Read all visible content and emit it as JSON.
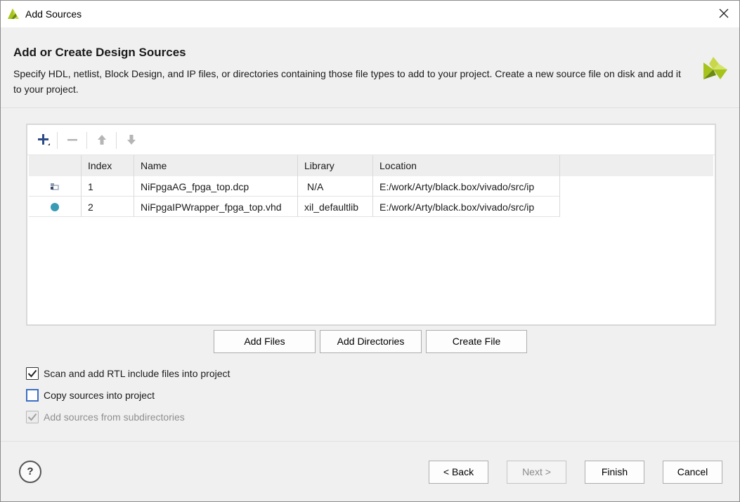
{
  "window": {
    "title": "Add Sources"
  },
  "header": {
    "title": "Add or Create Design Sources",
    "description": "Specify HDL, netlist, Block Design, and IP files, or directories containing those file types to add to your project. Create a new source file on disk and add it to your project."
  },
  "toolbar": {
    "add_icon": "plus-icon",
    "remove_icon": "minus-icon",
    "up_icon": "arrow-up-icon",
    "down_icon": "arrow-down-icon"
  },
  "table": {
    "columns": [
      "Index",
      "Name",
      "Library",
      "Location"
    ],
    "rows": [
      {
        "icon": "checkpoint-file-icon",
        "index": "1",
        "name": "NiFpgaAG_fpga_top.dcp",
        "library": "N/A",
        "location": "E:/work/Arty/black.box/vivado/src/ip"
      },
      {
        "icon": "hdl-file-icon",
        "index": "2",
        "name": "NiFpgaIPWrapper_fpga_top.vhd",
        "library": "xil_defaultlib",
        "location": "E:/work/Arty/black.box/vivado/src/ip"
      }
    ]
  },
  "actions": {
    "add_files": "Add Files",
    "add_directories": "Add Directories",
    "create_file": "Create File"
  },
  "options": {
    "scan_rtl": {
      "label": "Scan and add RTL include files into project",
      "checked": true
    },
    "copy_sources": {
      "label": "Copy sources into project",
      "checked": false
    },
    "subdirectories": {
      "label": "Add sources from subdirectories",
      "checked": true,
      "disabled": true
    }
  },
  "footer": {
    "help": "?",
    "back": "< Back",
    "next": "Next >",
    "finish": "Finish",
    "cancel": "Cancel"
  },
  "colors": {
    "accent": "#4a7fc1",
    "xilinx_green": "#a6c31c",
    "logo_dark": "#556b10"
  }
}
